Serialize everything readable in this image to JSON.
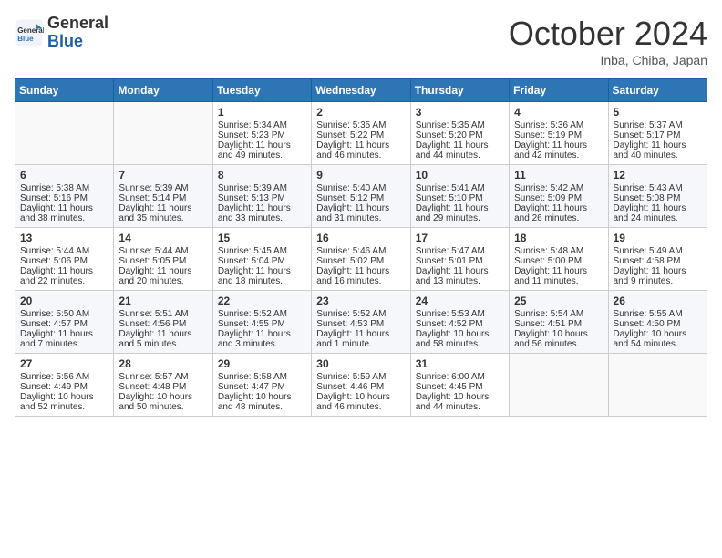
{
  "header": {
    "logo_text_general": "General",
    "logo_text_blue": "Blue",
    "month_title": "October 2024",
    "location": "Inba, Chiba, Japan"
  },
  "weekdays": [
    "Sunday",
    "Monday",
    "Tuesday",
    "Wednesday",
    "Thursday",
    "Friday",
    "Saturday"
  ],
  "weeks": [
    [
      {
        "day": null,
        "sunrise": null,
        "sunset": null,
        "daylight": null
      },
      {
        "day": null,
        "sunrise": null,
        "sunset": null,
        "daylight": null
      },
      {
        "day": "1",
        "sunrise": "Sunrise: 5:34 AM",
        "sunset": "Sunset: 5:23 PM",
        "daylight": "Daylight: 11 hours and 49 minutes."
      },
      {
        "day": "2",
        "sunrise": "Sunrise: 5:35 AM",
        "sunset": "Sunset: 5:22 PM",
        "daylight": "Daylight: 11 hours and 46 minutes."
      },
      {
        "day": "3",
        "sunrise": "Sunrise: 5:35 AM",
        "sunset": "Sunset: 5:20 PM",
        "daylight": "Daylight: 11 hours and 44 minutes."
      },
      {
        "day": "4",
        "sunrise": "Sunrise: 5:36 AM",
        "sunset": "Sunset: 5:19 PM",
        "daylight": "Daylight: 11 hours and 42 minutes."
      },
      {
        "day": "5",
        "sunrise": "Sunrise: 5:37 AM",
        "sunset": "Sunset: 5:17 PM",
        "daylight": "Daylight: 11 hours and 40 minutes."
      }
    ],
    [
      {
        "day": "6",
        "sunrise": "Sunrise: 5:38 AM",
        "sunset": "Sunset: 5:16 PM",
        "daylight": "Daylight: 11 hours and 38 minutes."
      },
      {
        "day": "7",
        "sunrise": "Sunrise: 5:39 AM",
        "sunset": "Sunset: 5:14 PM",
        "daylight": "Daylight: 11 hours and 35 minutes."
      },
      {
        "day": "8",
        "sunrise": "Sunrise: 5:39 AM",
        "sunset": "Sunset: 5:13 PM",
        "daylight": "Daylight: 11 hours and 33 minutes."
      },
      {
        "day": "9",
        "sunrise": "Sunrise: 5:40 AM",
        "sunset": "Sunset: 5:12 PM",
        "daylight": "Daylight: 11 hours and 31 minutes."
      },
      {
        "day": "10",
        "sunrise": "Sunrise: 5:41 AM",
        "sunset": "Sunset: 5:10 PM",
        "daylight": "Daylight: 11 hours and 29 minutes."
      },
      {
        "day": "11",
        "sunrise": "Sunrise: 5:42 AM",
        "sunset": "Sunset: 5:09 PM",
        "daylight": "Daylight: 11 hours and 26 minutes."
      },
      {
        "day": "12",
        "sunrise": "Sunrise: 5:43 AM",
        "sunset": "Sunset: 5:08 PM",
        "daylight": "Daylight: 11 hours and 24 minutes."
      }
    ],
    [
      {
        "day": "13",
        "sunrise": "Sunrise: 5:44 AM",
        "sunset": "Sunset: 5:06 PM",
        "daylight": "Daylight: 11 hours and 22 minutes."
      },
      {
        "day": "14",
        "sunrise": "Sunrise: 5:44 AM",
        "sunset": "Sunset: 5:05 PM",
        "daylight": "Daylight: 11 hours and 20 minutes."
      },
      {
        "day": "15",
        "sunrise": "Sunrise: 5:45 AM",
        "sunset": "Sunset: 5:04 PM",
        "daylight": "Daylight: 11 hours and 18 minutes."
      },
      {
        "day": "16",
        "sunrise": "Sunrise: 5:46 AM",
        "sunset": "Sunset: 5:02 PM",
        "daylight": "Daylight: 11 hours and 16 minutes."
      },
      {
        "day": "17",
        "sunrise": "Sunrise: 5:47 AM",
        "sunset": "Sunset: 5:01 PM",
        "daylight": "Daylight: 11 hours and 13 minutes."
      },
      {
        "day": "18",
        "sunrise": "Sunrise: 5:48 AM",
        "sunset": "Sunset: 5:00 PM",
        "daylight": "Daylight: 11 hours and 11 minutes."
      },
      {
        "day": "19",
        "sunrise": "Sunrise: 5:49 AM",
        "sunset": "Sunset: 4:58 PM",
        "daylight": "Daylight: 11 hours and 9 minutes."
      }
    ],
    [
      {
        "day": "20",
        "sunrise": "Sunrise: 5:50 AM",
        "sunset": "Sunset: 4:57 PM",
        "daylight": "Daylight: 11 hours and 7 minutes."
      },
      {
        "day": "21",
        "sunrise": "Sunrise: 5:51 AM",
        "sunset": "Sunset: 4:56 PM",
        "daylight": "Daylight: 11 hours and 5 minutes."
      },
      {
        "day": "22",
        "sunrise": "Sunrise: 5:52 AM",
        "sunset": "Sunset: 4:55 PM",
        "daylight": "Daylight: 11 hours and 3 minutes."
      },
      {
        "day": "23",
        "sunrise": "Sunrise: 5:52 AM",
        "sunset": "Sunset: 4:53 PM",
        "daylight": "Daylight: 11 hours and 1 minute."
      },
      {
        "day": "24",
        "sunrise": "Sunrise: 5:53 AM",
        "sunset": "Sunset: 4:52 PM",
        "daylight": "Daylight: 10 hours and 58 minutes."
      },
      {
        "day": "25",
        "sunrise": "Sunrise: 5:54 AM",
        "sunset": "Sunset: 4:51 PM",
        "daylight": "Daylight: 10 hours and 56 minutes."
      },
      {
        "day": "26",
        "sunrise": "Sunrise: 5:55 AM",
        "sunset": "Sunset: 4:50 PM",
        "daylight": "Daylight: 10 hours and 54 minutes."
      }
    ],
    [
      {
        "day": "27",
        "sunrise": "Sunrise: 5:56 AM",
        "sunset": "Sunset: 4:49 PM",
        "daylight": "Daylight: 10 hours and 52 minutes."
      },
      {
        "day": "28",
        "sunrise": "Sunrise: 5:57 AM",
        "sunset": "Sunset: 4:48 PM",
        "daylight": "Daylight: 10 hours and 50 minutes."
      },
      {
        "day": "29",
        "sunrise": "Sunrise: 5:58 AM",
        "sunset": "Sunset: 4:47 PM",
        "daylight": "Daylight: 10 hours and 48 minutes."
      },
      {
        "day": "30",
        "sunrise": "Sunrise: 5:59 AM",
        "sunset": "Sunset: 4:46 PM",
        "daylight": "Daylight: 10 hours and 46 minutes."
      },
      {
        "day": "31",
        "sunrise": "Sunrise: 6:00 AM",
        "sunset": "Sunset: 4:45 PM",
        "daylight": "Daylight: 10 hours and 44 minutes."
      },
      {
        "day": null,
        "sunrise": null,
        "sunset": null,
        "daylight": null
      },
      {
        "day": null,
        "sunrise": null,
        "sunset": null,
        "daylight": null
      }
    ]
  ]
}
